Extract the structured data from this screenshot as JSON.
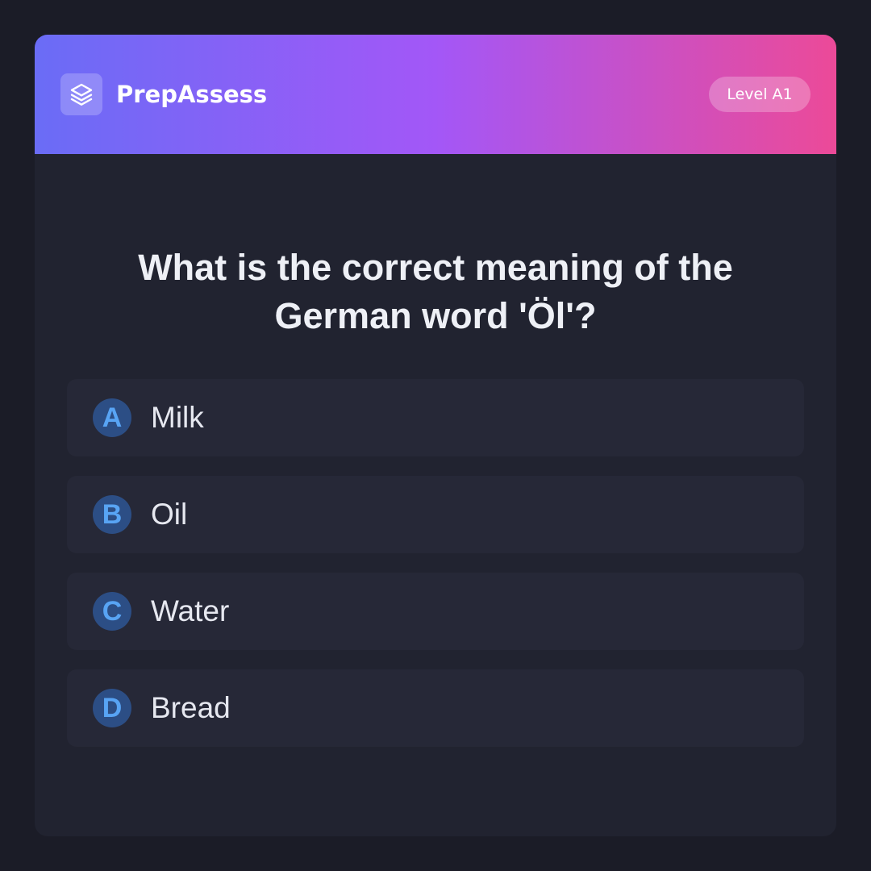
{
  "header": {
    "logo_icon": "layers-icon",
    "brand": "PrepAssess",
    "level": "Level A1",
    "gradient": [
      "#6a6cf6",
      "#a357f7",
      "#ec4a98"
    ]
  },
  "question": {
    "text": "What is the correct meaning of the German word 'Öl'?"
  },
  "options": [
    {
      "letter": "A",
      "label": "Milk"
    },
    {
      "letter": "B",
      "label": "Oil"
    },
    {
      "letter": "C",
      "label": "Water"
    },
    {
      "letter": "D",
      "label": "Bread"
    }
  ],
  "colors": {
    "background": "#1b1c27",
    "card": "#212330",
    "option_bg": "#262837",
    "letter_bg": "#2c4e85",
    "letter_fg": "#58a4f4"
  }
}
